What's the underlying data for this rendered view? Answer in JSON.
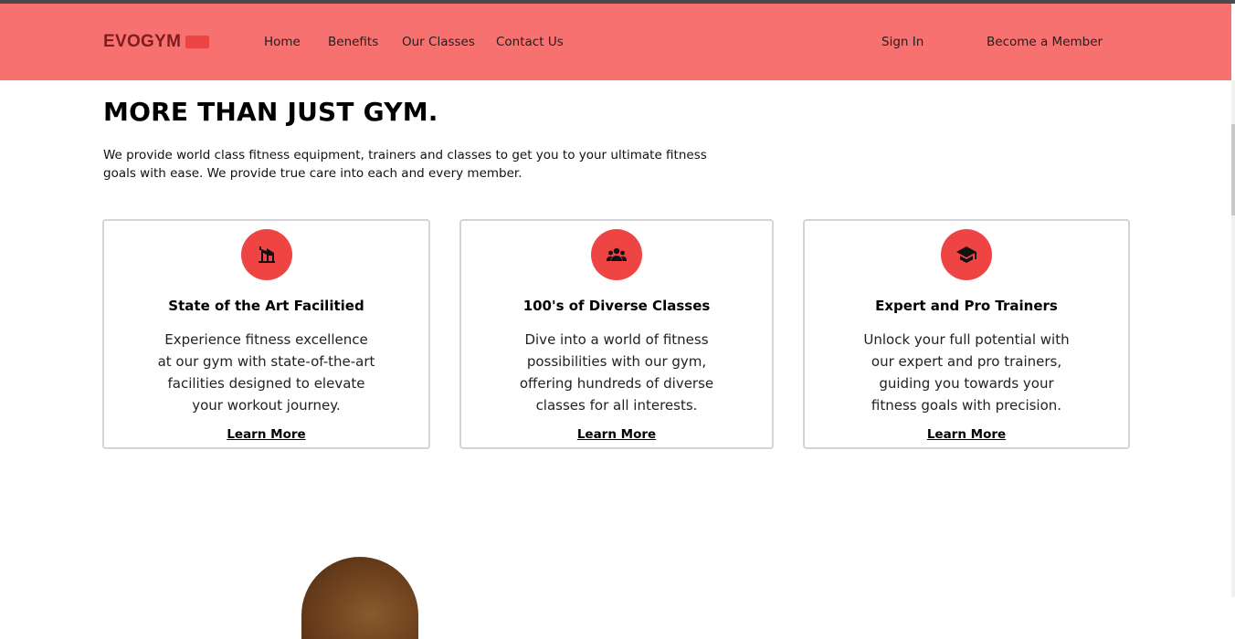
{
  "brand": {
    "name": "EVOGYM",
    "accent_color": "#ef4444",
    "nav_bg": "#f87171"
  },
  "nav": {
    "links": [
      "Home",
      "Benefits",
      "Our Classes",
      "Contact Us"
    ],
    "sign_in": "Sign In",
    "become_member": "Become a Member"
  },
  "hero": {
    "title": "MORE THAN JUST GYM.",
    "description": "We provide world class fitness equipment, trainers and classes to get you to your ultimate fitness goals with ease. We provide true care into each and every member."
  },
  "benefits": [
    {
      "icon": "home-modern-icon",
      "title": "State of the Art Facilitied",
      "text": "Experience fitness excellence at our gym with state-of-the-art facilities designed to elevate your workout journey.",
      "link": "Learn More"
    },
    {
      "icon": "user-group-icon",
      "title": "100's of Diverse Classes",
      "text": "Dive into a world of fitness possibilities with our gym, offering hundreds of diverse classes for all interests.",
      "link": "Learn More"
    },
    {
      "icon": "academic-cap-icon",
      "title": "Expert and Pro Trainers",
      "text": "Unlock your full potential with our expert and pro trainers, guiding you towards your fitness goals with precision.",
      "link": "Learn More"
    }
  ]
}
